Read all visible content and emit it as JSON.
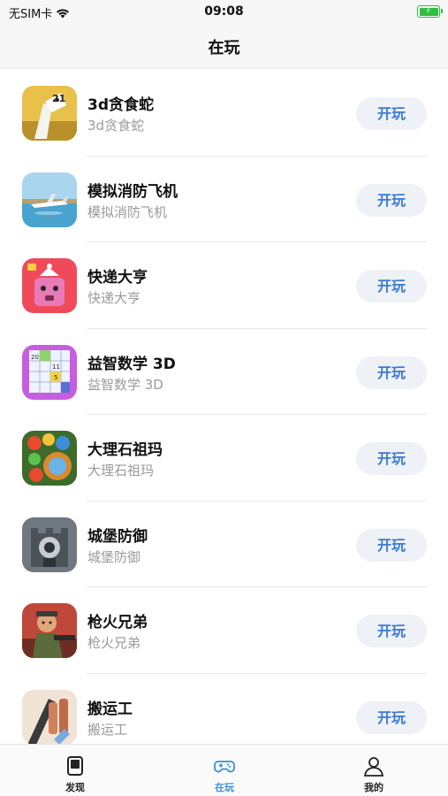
{
  "status_bar": {
    "carrier": "无SIM卡",
    "time": "09:08"
  },
  "header": {
    "title": "在玩"
  },
  "games": [
    {
      "name": "3d贪食蛇",
      "subtitle": "3d贪食蛇",
      "button": "开玩",
      "icon": "snake-game-icon"
    },
    {
      "name": "模拟消防飞机",
      "subtitle": "模拟消防飞机",
      "button": "开玩",
      "icon": "fire-plane-game-icon"
    },
    {
      "name": "快递大亨",
      "subtitle": "快递大亨",
      "button": "开玩",
      "icon": "delivery-tycoon-game-icon"
    },
    {
      "name": "益智数学 3D",
      "subtitle": "益智数学 3D",
      "button": "开玩",
      "icon": "math-puzzle-game-icon"
    },
    {
      "name": "大理石祖玛",
      "subtitle": "大理石祖玛",
      "button": "开玩",
      "icon": "marble-zuma-game-icon"
    },
    {
      "name": "城堡防御",
      "subtitle": "城堡防御",
      "button": "开玩",
      "icon": "castle-defense-game-icon"
    },
    {
      "name": "枪火兄弟",
      "subtitle": "枪火兄弟",
      "button": "开玩",
      "icon": "gun-brothers-game-icon"
    },
    {
      "name": "搬运工",
      "subtitle": "搬运工",
      "button": "开玩",
      "icon": "porter-game-icon"
    }
  ],
  "tabs": [
    {
      "label": "发现",
      "icon": "discover-icon",
      "active": false
    },
    {
      "label": "在玩",
      "icon": "gamepad-icon",
      "active": true
    },
    {
      "label": "我的",
      "icon": "profile-icon",
      "active": false
    }
  ],
  "colors": {
    "accent": "#3a8fd8",
    "button_bg": "#eef1f5",
    "button_text": "#3a7bd5",
    "battery": "#2fbf3f"
  }
}
